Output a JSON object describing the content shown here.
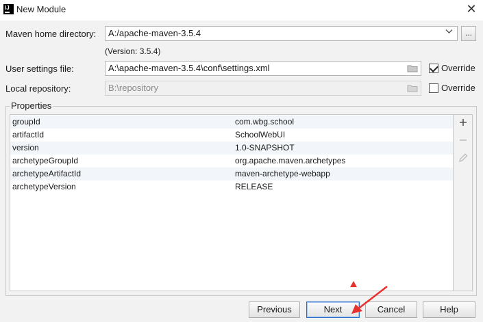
{
  "window": {
    "title": "New Module",
    "app_icon_letters": "IJ"
  },
  "form": {
    "maven_home_label": "Maven home directory:",
    "maven_home_value": "A:/apache-maven-3.5.4",
    "version_text": "(Version: 3.5.4)",
    "user_settings_label": "User settings file:",
    "user_settings_value": "A:\\apache-maven-3.5.4\\conf\\settings.xml",
    "user_settings_override_label": "Override",
    "user_settings_override_checked": true,
    "local_repo_label": "Local repository:",
    "local_repo_value": "B:\\repository",
    "local_repo_override_label": "Override",
    "local_repo_override_checked": false,
    "browse_button_label": "..."
  },
  "properties": {
    "group_title": "Properties",
    "rows": [
      {
        "key": "groupId",
        "value": "com.wbg.school"
      },
      {
        "key": "artifactId",
        "value": "SchoolWebUI"
      },
      {
        "key": "version",
        "value": "1.0-SNAPSHOT"
      },
      {
        "key": "archetypeGroupId",
        "value": "org.apache.maven.archetypes"
      },
      {
        "key": "archetypeArtifactId",
        "value": "maven-archetype-webapp"
      },
      {
        "key": "archetypeVersion",
        "value": "RELEASE"
      }
    ],
    "add_icon": "plus-icon",
    "remove_icon": "minus-icon",
    "edit_icon": "pencil-icon"
  },
  "buttons": {
    "previous": "Previous",
    "next": "Next",
    "cancel": "Cancel",
    "help": "Help"
  },
  "colors": {
    "annotation": "#e8302d",
    "default_button_border": "#2b6fc9"
  }
}
